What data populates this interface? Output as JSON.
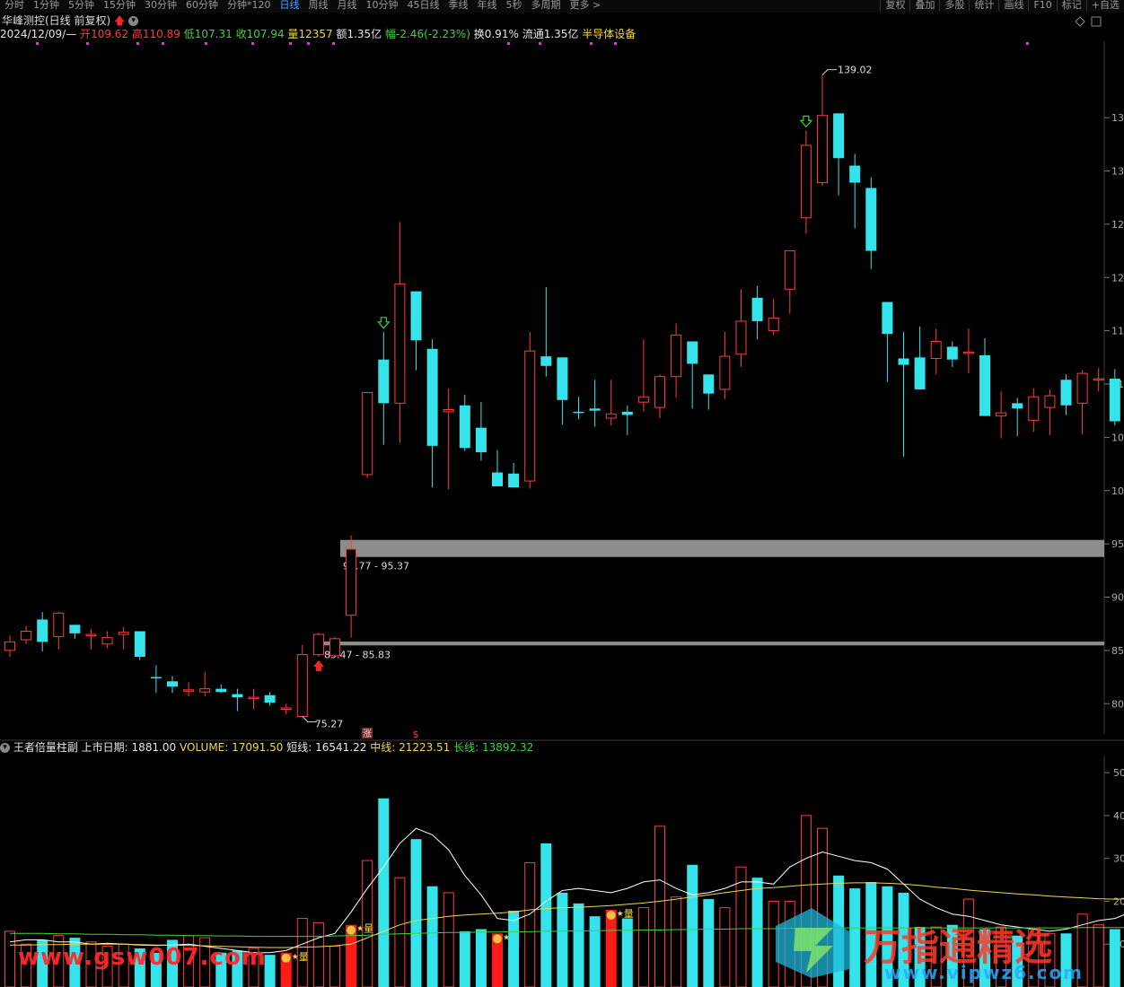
{
  "toolbar": {
    "tabs": [
      "分时",
      "1分钟",
      "5分钟",
      "15分钟",
      "30分钟",
      "60分钟",
      "分钟*120",
      "日线",
      "周线",
      "月线",
      "10分钟",
      "45日线",
      "季线",
      "年线",
      "5秒",
      "多周期",
      "更多 >"
    ],
    "active_tab": "日线",
    "right_tabs": [
      "复权",
      "叠加",
      "多股",
      "统计",
      "画线",
      "F10",
      "标记",
      "+自选"
    ]
  },
  "header": {
    "title": "华峰测控(日线 前复权)",
    "date": "2024/12/09/—",
    "open_label": "开",
    "open": "109.62",
    "high_label": "高",
    "high": "110.89",
    "low_label": "低",
    "low": "107.31",
    "close_label": "收",
    "close": "107.94",
    "vol_label": "量",
    "vol": "12357",
    "amount": "额1.35亿",
    "change_label": "幅",
    "change": "-2.46(-2.23%)",
    "turnover": "换0.91%",
    "float_cap": "流通1.35亿",
    "sector": "半导体设备"
  },
  "indicator": {
    "name": "王者倍量柱副",
    "listing_label": "上市日期:",
    "listing": "1881.00",
    "volume_label": "VOLUME:",
    "volume": "17091.50",
    "short_label": "短线:",
    "short": "16541.22",
    "mid_label": "中线:",
    "mid": "21223.51",
    "long_label": "长线:",
    "long": "13892.32"
  },
  "annotations": {
    "high_mark": "139.02",
    "low_mark": "75.27",
    "zone_upper": "93.77 - 95.37",
    "zone_lower": "85.47 - 85.83",
    "badge_zhang": "涨",
    "badge_s": "$",
    "vol_tag": "量"
  },
  "watermarks": {
    "left": "www.gsw007.com",
    "right_main": "万指通精选",
    "right_sub": "www.vipwz6.com"
  },
  "colors": {
    "up": "#ff3b3b",
    "down": "#35e3ea",
    "zone": "#8c8c8c",
    "mid": "#f0d84a",
    "long": "#3fd23f",
    "short": "#ffffff"
  },
  "chart_data": [
    {
      "type": "candlestick",
      "title": "华峰测控(日线 前复权)",
      "y_ticks": [
        80,
        85,
        90,
        95,
        100,
        105,
        110,
        115,
        120,
        125,
        130,
        135
      ],
      "ylim": [
        78,
        142
      ],
      "candles": [
        {
          "o": 85.0,
          "h": 86.4,
          "l": 84.4,
          "c": 85.8
        },
        {
          "o": 86.0,
          "h": 87.3,
          "l": 85.6,
          "c": 86.8
        },
        {
          "o": 87.9,
          "h": 88.6,
          "l": 84.9,
          "c": 85.8
        },
        {
          "o": 86.3,
          "h": 88.6,
          "l": 85.1,
          "c": 88.5
        },
        {
          "o": 87.4,
          "h": 87.4,
          "l": 86.1,
          "c": 86.6
        },
        {
          "o": 86.5,
          "h": 87.0,
          "l": 85.1,
          "c": 86.5
        },
        {
          "o": 85.6,
          "h": 86.8,
          "l": 85.2,
          "c": 86.2
        },
        {
          "o": 86.5,
          "h": 87.2,
          "l": 85.1,
          "c": 86.7
        },
        {
          "o": 86.8,
          "h": 86.8,
          "l": 84.1,
          "c": 84.4
        },
        {
          "o": 82.5,
          "h": 83.6,
          "l": 81.0,
          "c": 82.4
        },
        {
          "o": 82.1,
          "h": 82.6,
          "l": 81.0,
          "c": 81.6
        },
        {
          "o": 81.3,
          "h": 82.0,
          "l": 80.7,
          "c": 81.3
        },
        {
          "o": 81.1,
          "h": 83.0,
          "l": 80.7,
          "c": 81.4
        },
        {
          "o": 81.4,
          "h": 81.8,
          "l": 81.0,
          "c": 81.1
        },
        {
          "o": 80.9,
          "h": 81.4,
          "l": 79.3,
          "c": 80.6
        },
        {
          "o": 80.6,
          "h": 81.4,
          "l": 79.5,
          "c": 80.6
        },
        {
          "o": 80.8,
          "h": 81.1,
          "l": 79.8,
          "c": 80.1
        },
        {
          "o": 79.5,
          "h": 80.0,
          "l": 79.0,
          "c": 79.6
        },
        {
          "o": 78.8,
          "h": 85.5,
          "l": 78.8,
          "c": 84.6
        },
        {
          "o": 84.6,
          "h": 86.7,
          "l": 84.4,
          "c": 86.5
        },
        {
          "o": 84.5,
          "h": 86.3,
          "l": 84.5,
          "c": 86.1
        },
        {
          "o": 88.3,
          "h": 95.8,
          "l": 86.2,
          "c": 94.5
        },
        {
          "o": 101.5,
          "h": 107.1,
          "l": 101.2,
          "c": 109.2
        },
        {
          "o": 112.3,
          "h": 114.9,
          "l": 104.3,
          "c": 108.2
        },
        {
          "o": 108.2,
          "h": 125.2,
          "l": 104.5,
          "c": 119.4
        },
        {
          "o": 118.7,
          "h": 118.3,
          "l": 111.3,
          "c": 114.1
        },
        {
          "o": 113.3,
          "h": 114.2,
          "l": 100.3,
          "c": 104.2
        },
        {
          "o": 107.4,
          "h": 109.6,
          "l": 100.1,
          "c": 107.6
        },
        {
          "o": 108.0,
          "h": 109.0,
          "l": 103.7,
          "c": 104.0
        },
        {
          "o": 105.9,
          "h": 108.3,
          "l": 102.8,
          "c": 103.6
        },
        {
          "o": 101.7,
          "h": 103.8,
          "l": 100.9,
          "c": 100.4
        },
        {
          "o": 101.6,
          "h": 102.6,
          "l": 100.3,
          "c": 100.3
        },
        {
          "o": 100.9,
          "h": 114.9,
          "l": 100.2,
          "c": 113.1
        },
        {
          "o": 112.6,
          "h": 119.1,
          "l": 110.7,
          "c": 111.7
        },
        {
          "o": 112.5,
          "h": 111.6,
          "l": 106.2,
          "c": 108.5
        },
        {
          "o": 107.4,
          "h": 108.8,
          "l": 106.7,
          "c": 107.3
        },
        {
          "o": 107.7,
          "h": 110.4,
          "l": 106.0,
          "c": 107.5
        },
        {
          "o": 106.8,
          "h": 110.4,
          "l": 106.1,
          "c": 107.2
        },
        {
          "o": 107.4,
          "h": 108.0,
          "l": 105.2,
          "c": 107.1
        },
        {
          "o": 108.3,
          "h": 114.2,
          "l": 107.4,
          "c": 108.8
        },
        {
          "o": 107.8,
          "h": 110.9,
          "l": 106.8,
          "c": 110.7
        },
        {
          "o": 110.7,
          "h": 115.7,
          "l": 108.7,
          "c": 114.6
        },
        {
          "o": 114.0,
          "h": 114.0,
          "l": 107.7,
          "c": 111.9
        },
        {
          "o": 110.9,
          "h": 110.5,
          "l": 107.6,
          "c": 109.1
        },
        {
          "o": 109.5,
          "h": 114.9,
          "l": 108.6,
          "c": 112.6
        },
        {
          "o": 112.8,
          "h": 118.9,
          "l": 111.6,
          "c": 115.9
        },
        {
          "o": 118.1,
          "h": 119.2,
          "l": 114.2,
          "c": 115.9
        },
        {
          "o": 115.0,
          "h": 118.0,
          "l": 114.6,
          "c": 116.2
        },
        {
          "o": 118.9,
          "h": 121.4,
          "l": 116.6,
          "c": 122.5
        },
        {
          "o": 125.6,
          "h": 133.8,
          "l": 124.1,
          "c": 132.4
        },
        {
          "o": 128.9,
          "h": 139.0,
          "l": 128.6,
          "c": 135.2
        },
        {
          "o": 135.4,
          "h": 135.2,
          "l": 127.7,
          "c": 131.2
        },
        {
          "o": 130.5,
          "h": 131.6,
          "l": 124.6,
          "c": 128.9
        },
        {
          "o": 128.4,
          "h": 129.4,
          "l": 120.8,
          "c": 122.5
        },
        {
          "o": 117.7,
          "h": 117.2,
          "l": 110.2,
          "c": 114.7
        },
        {
          "o": 112.4,
          "h": 114.9,
          "l": 103.2,
          "c": 111.8
        },
        {
          "o": 112.5,
          "h": 115.4,
          "l": 110.2,
          "c": 109.5
        },
        {
          "o": 112.4,
          "h": 115.2,
          "l": 110.9,
          "c": 114.0
        },
        {
          "o": 113.5,
          "h": 114.0,
          "l": 111.6,
          "c": 112.3
        },
        {
          "o": 113.0,
          "h": 115.2,
          "l": 111.0,
          "c": 113.0
        },
        {
          "o": 112.7,
          "h": 114.3,
          "l": 110.8,
          "c": 107.0
        },
        {
          "o": 107.0,
          "h": 109.3,
          "l": 104.9,
          "c": 107.3
        },
        {
          "o": 108.2,
          "h": 108.7,
          "l": 105.1,
          "c": 107.7
        },
        {
          "o": 106.6,
          "h": 109.6,
          "l": 105.5,
          "c": 108.8
        },
        {
          "o": 107.8,
          "h": 109.5,
          "l": 105.2,
          "c": 108.9
        },
        {
          "o": 110.4,
          "h": 110.9,
          "l": 107.1,
          "c": 108.0
        },
        {
          "o": 108.2,
          "h": 111.3,
          "l": 105.3,
          "c": 111.0
        },
        {
          "o": 110.5,
          "h": 111.5,
          "l": 109.3,
          "c": 110.5
        },
        {
          "o": 110.5,
          "h": 111.4,
          "l": 106.1,
          "c": 106.5
        },
        {
          "o": 108.1,
          "h": 109.8,
          "l": 107.1,
          "c": 107.6
        },
        {
          "o": 107.8,
          "h": 108.9,
          "l": 105.1,
          "c": 107.4
        },
        {
          "o": 106.6,
          "h": 108.7,
          "l": 106.3,
          "c": 107.7
        },
        {
          "o": 109.6,
          "h": 108.1,
          "l": 105.2,
          "c": 107.9
        }
      ],
      "zones": [
        {
          "label": "93.77 - 95.37",
          "from": 93.77,
          "to": 95.37
        },
        {
          "label": "85.47 - 85.83",
          "from": 85.47,
          "to": 85.83
        }
      ]
    },
    {
      "type": "bar",
      "title": "王者倍量柱副",
      "y_ticks": [
        10000,
        20000,
        30000,
        40000,
        50000
      ],
      "ylim": [
        0,
        54000
      ],
      "series": [
        {
          "name": "VOLUME",
          "values": [
            13000,
            10000,
            11000,
            12000,
            11500,
            10500,
            9500,
            10000,
            9000,
            8000,
            11000,
            12000,
            11500,
            8000,
            8500,
            9000,
            7500,
            8000,
            16000,
            15000,
            9500,
            14500,
            29500,
            44000,
            25500,
            34500,
            23500,
            22000,
            13000,
            13500,
            12500,
            17800,
            29000,
            33500,
            22000,
            19500,
            16500,
            18000,
            16000,
            18500,
            37500,
            21000,
            28500,
            20500,
            18500,
            28000,
            25500,
            20000,
            20000,
            40000,
            37000,
            26000,
            23000,
            24500,
            23500,
            22000,
            14000,
            14000,
            14500,
            20500,
            13500,
            14000,
            12000,
            13500,
            12500,
            12500,
            17000,
            14500,
            13500,
            18000,
            16000,
            14500,
            14500
          ]
        },
        {
          "name": "短线",
          "values": [
            10500,
            11000,
            11000,
            10500,
            10500,
            10000,
            10200,
            10000,
            9800,
            9700,
            9800,
            10000,
            9500,
            9000,
            8500,
            8000,
            8000,
            8500,
            10000,
            11500,
            12500,
            17500,
            23000,
            28000,
            33500,
            37000,
            35500,
            32000,
            26000,
            21500,
            16000,
            15500,
            17000,
            20000,
            22500,
            23000,
            22500,
            22000,
            23000,
            24500,
            25000,
            23000,
            21500,
            22000,
            23000,
            24500,
            24500,
            24000,
            28000,
            30000,
            31500,
            30500,
            29500,
            29000,
            27500,
            24000,
            20500,
            18500,
            17000,
            16500,
            15500,
            14500,
            14000,
            13500,
            13000,
            13500,
            14500,
            15500,
            16000,
            17500,
            17500,
            17000,
            17091
          ]
        },
        {
          "name": "中线",
          "values": [
            9800,
            9800,
            9900,
            9900,
            10000,
            10000,
            10000,
            10000,
            9900,
            9800,
            9800,
            9700,
            9600,
            9500,
            9400,
            9300,
            9200,
            9200,
            9300,
            9400,
            9600,
            10000,
            11500,
            13000,
            14500,
            15500,
            16000,
            16500,
            16800,
            17000,
            17200,
            17500,
            18000,
            18300,
            18500,
            18600,
            18800,
            19000,
            19300,
            19600,
            20000,
            20500,
            21000,
            21500,
            22000,
            22500,
            23000,
            23200,
            23500,
            23800,
            24000,
            24200,
            24300,
            24300,
            24200,
            24000,
            23700,
            23300,
            23000,
            22600,
            22300,
            22000,
            21700,
            21500,
            21200,
            21000,
            20800,
            20600,
            20500,
            20600,
            20800,
            20900,
            21224
          ]
        },
        {
          "name": "长线",
          "values": [
            12500,
            12500,
            12500,
            12400,
            12400,
            12300,
            12300,
            12200,
            12200,
            12100,
            12100,
            12000,
            12000,
            11900,
            11900,
            11800,
            11800,
            11800,
            11800,
            11800,
            11900,
            12000,
            12100,
            12300,
            12400,
            12500,
            12600,
            12700,
            12700,
            12800,
            12800,
            12900,
            12900,
            13000,
            13000,
            13100,
            13100,
            13200,
            13200,
            13300,
            13300,
            13400,
            13400,
            13500,
            13500,
            13600,
            13600,
            13600,
            13700,
            13700,
            13700,
            13800,
            13800,
            13800,
            13800,
            13800,
            13800,
            13800,
            13800,
            13800,
            13800,
            13800,
            13800,
            13800,
            13800,
            13800,
            13850,
            13850,
            13850,
            13870,
            13880,
            13890,
            13892
          ]
        }
      ],
      "double_volume_days": [
        17,
        21,
        30,
        37
      ]
    }
  ]
}
